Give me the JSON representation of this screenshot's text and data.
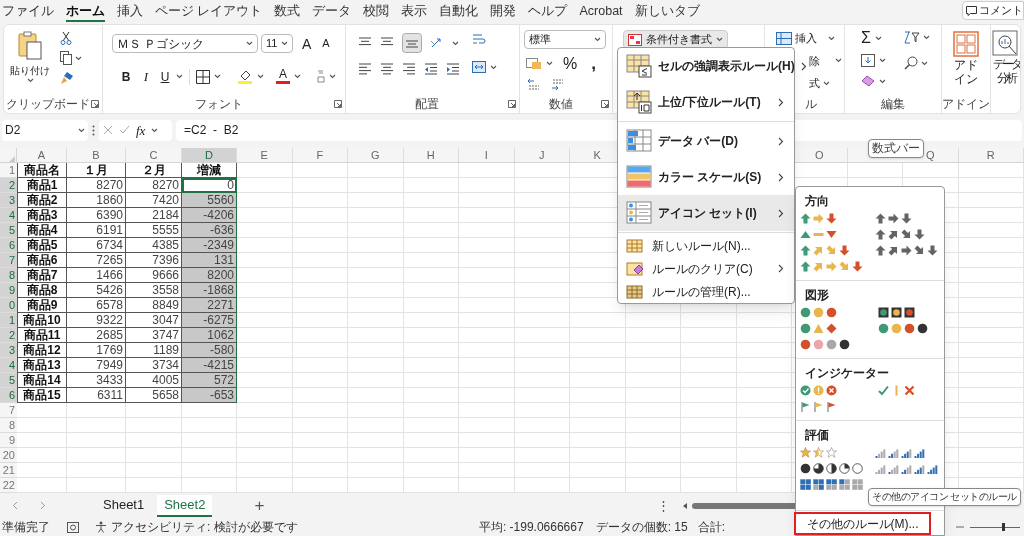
{
  "ribbon_tabs": [
    {
      "label": "ファイル",
      "selected": false
    },
    {
      "label": "ホーム",
      "selected": true
    },
    {
      "label": "挿入",
      "selected": false
    },
    {
      "label": "ページ レイアウト",
      "selected": false
    },
    {
      "label": "数式",
      "selected": false
    },
    {
      "label": "データ",
      "selected": false
    },
    {
      "label": "校閲",
      "selected": false
    },
    {
      "label": "表示",
      "selected": false
    },
    {
      "label": "自動化",
      "selected": false
    },
    {
      "label": "開発",
      "selected": false
    },
    {
      "label": "ヘルプ",
      "selected": false
    },
    {
      "label": "Acrobat",
      "selected": false
    },
    {
      "label": "新しいタブ",
      "selected": false
    }
  ],
  "comment_button": "コメント",
  "clipboard": {
    "paste": "貼り付け",
    "label": "クリップボード"
  },
  "font": {
    "name": "ＭＳ Ｐゴシック",
    "size": "11",
    "grow": "A",
    "shrink": "A",
    "bold": "B",
    "italic": "I",
    "underline": "U",
    "font_color": "A",
    "label": "フォント"
  },
  "alignment": {
    "label": "配置"
  },
  "number": {
    "format": "標準",
    "percent": "%",
    "comma": ",",
    "label": "数値"
  },
  "styles": {
    "conditional_formatting": "条件付き書式"
  },
  "cells": {
    "insert": "挿入",
    "delete": "除",
    "format": "式",
    "label": "ル"
  },
  "editing": {
    "sum": "Σ",
    "label": "編集"
  },
  "addins": {
    "button": "アドイン",
    "label": "アドイン"
  },
  "data_analysis": {
    "button": "データ分析"
  },
  "formula_bar": {
    "name_box": "D2",
    "fx": "fx",
    "formula": "=C2  -  B2",
    "tooltip": "数式バー"
  },
  "sheet": {
    "columns": [
      "A",
      "B",
      "C",
      "D",
      "E",
      "F",
      "G",
      "H",
      "I",
      "J",
      "K",
      "O",
      "Q",
      "R"
    ],
    "rows": [
      {
        "header": "1",
        "cells": [
          "商品名",
          "１月",
          "２月",
          "増減"
        ],
        "selected": false,
        "active": false
      },
      {
        "header": "2",
        "cells": [
          "商品1",
          "8270",
          "8270",
          "0"
        ],
        "selected": true,
        "active": true
      },
      {
        "header": "3",
        "cells": [
          "商品2",
          "1860",
          "7420",
          "5560"
        ],
        "selected": true,
        "active": false
      },
      {
        "header": "4",
        "cells": [
          "商品3",
          "6390",
          "2184",
          "-4206"
        ],
        "selected": true,
        "active": false
      },
      {
        "header": "5",
        "cells": [
          "商品4",
          "6191",
          "5555",
          "-636"
        ],
        "selected": true,
        "active": false
      },
      {
        "header": "6",
        "cells": [
          "商品5",
          "6734",
          "4385",
          "-2349"
        ],
        "selected": true,
        "active": false
      },
      {
        "header": "7",
        "cells": [
          "商品6",
          "7265",
          "7396",
          "131"
        ],
        "selected": true,
        "active": false
      },
      {
        "header": "8",
        "cells": [
          "商品7",
          "1466",
          "9666",
          "8200"
        ],
        "selected": true,
        "active": false
      },
      {
        "header": "9",
        "cells": [
          "商品8",
          "5426",
          "3558",
          "-1868"
        ],
        "selected": true,
        "active": false
      },
      {
        "header": "0",
        "cells": [
          "商品9",
          "6578",
          "8849",
          "2271"
        ],
        "selected": true,
        "active": false
      },
      {
        "header": "1",
        "cells": [
          "商品10",
          "9322",
          "3047",
          "-6275"
        ],
        "selected": true,
        "active": false
      },
      {
        "header": "2",
        "cells": [
          "商品11",
          "2685",
          "3747",
          "1062"
        ],
        "selected": true,
        "active": false
      },
      {
        "header": "3",
        "cells": [
          "商品12",
          "1769",
          "1189",
          "-580"
        ],
        "selected": true,
        "active": false
      },
      {
        "header": "4",
        "cells": [
          "商品13",
          "7949",
          "3734",
          "-4215"
        ],
        "selected": true,
        "active": false
      },
      {
        "header": "5",
        "cells": [
          "商品14",
          "3433",
          "4005",
          "572"
        ],
        "selected": true,
        "active": false
      },
      {
        "header": "6",
        "cells": [
          "商品15",
          "6311",
          "5658",
          "-653"
        ],
        "selected": true,
        "active": false
      },
      {
        "header": "7",
        "selected": false,
        "active": false
      },
      {
        "header": "8",
        "selected": false,
        "active": false
      },
      {
        "header": "9",
        "selected": false,
        "active": false
      },
      {
        "header": "20",
        "selected": false,
        "active": false
      },
      {
        "header": "21",
        "selected": false,
        "active": false
      },
      {
        "header": "22",
        "selected": false,
        "active": false
      }
    ]
  },
  "sheet_tabs": {
    "tabs": [
      {
        "label": "Sheet1",
        "selected": false
      },
      {
        "label": "Sheet2",
        "selected": true
      }
    ],
    "add": "+",
    "more": "⋮"
  },
  "status_bar": {
    "ready": "準備完了",
    "accessibility": "アクセシビリティ: 検討が必要です",
    "average": "平均: -199.0666667",
    "count": "データの個数: 15",
    "sum": "合計:",
    "zoom_slider": {
      "level": 0.66
    }
  },
  "cf_menu": {
    "sections": [
      {
        "items": [
          {
            "kind": "large",
            "label": "セルの強調表示ルール(H)",
            "submenu": true,
            "selected": false
          },
          {
            "kind": "large",
            "label": "上位/下位ルール(T)",
            "submenu": true,
            "selected": false
          }
        ]
      },
      {
        "items": [
          {
            "kind": "large",
            "label": "データ バー(D)",
            "submenu": true,
            "selected": false
          },
          {
            "kind": "large",
            "label": "カラー スケール(S)",
            "submenu": true,
            "selected": false
          },
          {
            "kind": "large",
            "label": "アイコン セット(I)",
            "submenu": true,
            "selected": true
          }
        ]
      },
      {
        "items": [
          {
            "kind": "small",
            "label": "新しいルール(N)...",
            "submenu": false,
            "selected": false
          },
          {
            "kind": "small",
            "label": "ルールのクリア(C)",
            "submenu": true,
            "selected": false
          },
          {
            "kind": "small",
            "label": "ルールの管理(R)...",
            "submenu": false,
            "selected": false
          }
        ]
      }
    ]
  },
  "icon_sets_menu": {
    "sections": [
      {
        "title": "方向"
      },
      {
        "title": "図形"
      },
      {
        "title": "インジケーター"
      },
      {
        "title": "評価"
      }
    ],
    "more_rules": {
      "label": "その他のルール(M)...",
      "highlighted": true
    },
    "tooltip": "その他のアイコン セットのルール"
  }
}
